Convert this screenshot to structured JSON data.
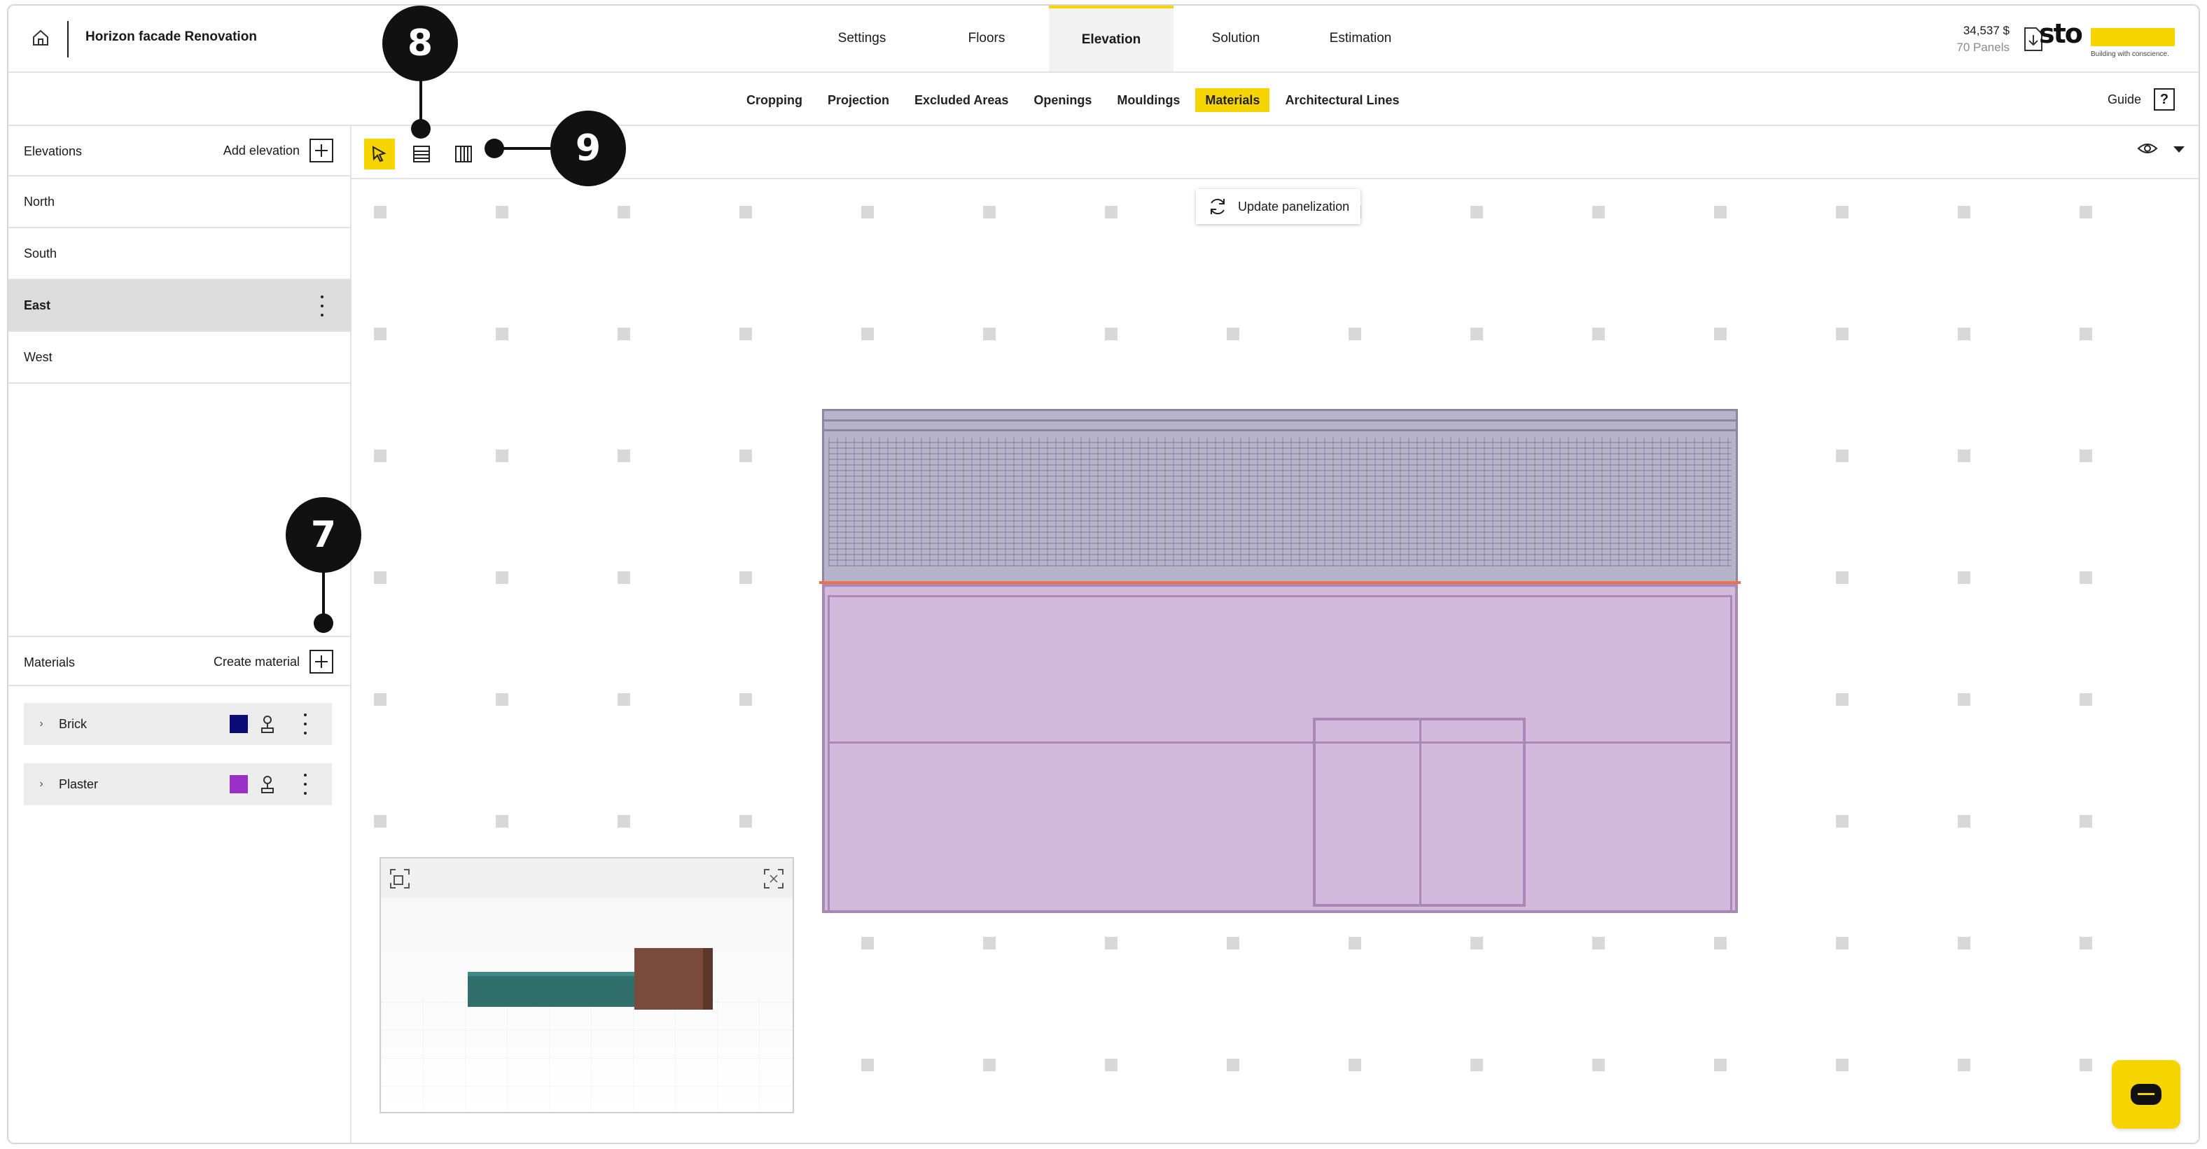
{
  "header": {
    "project_title": "Horizon facade Renovation",
    "tabs": [
      {
        "label": "Settings"
      },
      {
        "label": "Floors"
      },
      {
        "label": "Elevation"
      },
      {
        "label": "Solution"
      },
      {
        "label": "Estimation"
      }
    ],
    "active_tab": "Elevation",
    "cost": "34,537 $",
    "panels": "70 Panels",
    "brand_logo": "sto",
    "brand_tagline": "Building with conscience."
  },
  "subnav": {
    "tabs": [
      {
        "label": "Cropping"
      },
      {
        "label": "Projection"
      },
      {
        "label": "Excluded Areas"
      },
      {
        "label": "Openings"
      },
      {
        "label": "Mouldings"
      },
      {
        "label": "Materials"
      },
      {
        "label": "Architectural Lines"
      }
    ],
    "active_tab": "Materials",
    "guide_label": "Guide",
    "guide_icon": "?"
  },
  "sidebar": {
    "elevations_title": "Elevations",
    "add_elevation_label": "Add elevation",
    "elevations": [
      {
        "label": "North"
      },
      {
        "label": "South"
      },
      {
        "label": "East"
      },
      {
        "label": "West"
      }
    ],
    "selected_elevation": "East",
    "materials_title": "Materials",
    "create_material_label": "Create material",
    "materials": [
      {
        "label": "Brick",
        "color": "#0b0b7a"
      },
      {
        "label": "Plaster",
        "color": "#9b30c9"
      }
    ]
  },
  "toolbar": {
    "tools": [
      "select-arrow-icon",
      "fill-horizontal-pattern-icon",
      "fill-vertical-pattern-icon"
    ],
    "active_tool": "select-arrow-icon"
  },
  "canvas": {
    "update_button_label": "Update panelization"
  },
  "callouts": [
    {
      "number": "7"
    },
    {
      "number": "8"
    },
    {
      "number": "9"
    }
  ],
  "colors": {
    "accent": "#f5d400",
    "facade_top": "#b7b3c8",
    "facade_bottom": "#d3badd",
    "floor_line": "#e8734d"
  }
}
